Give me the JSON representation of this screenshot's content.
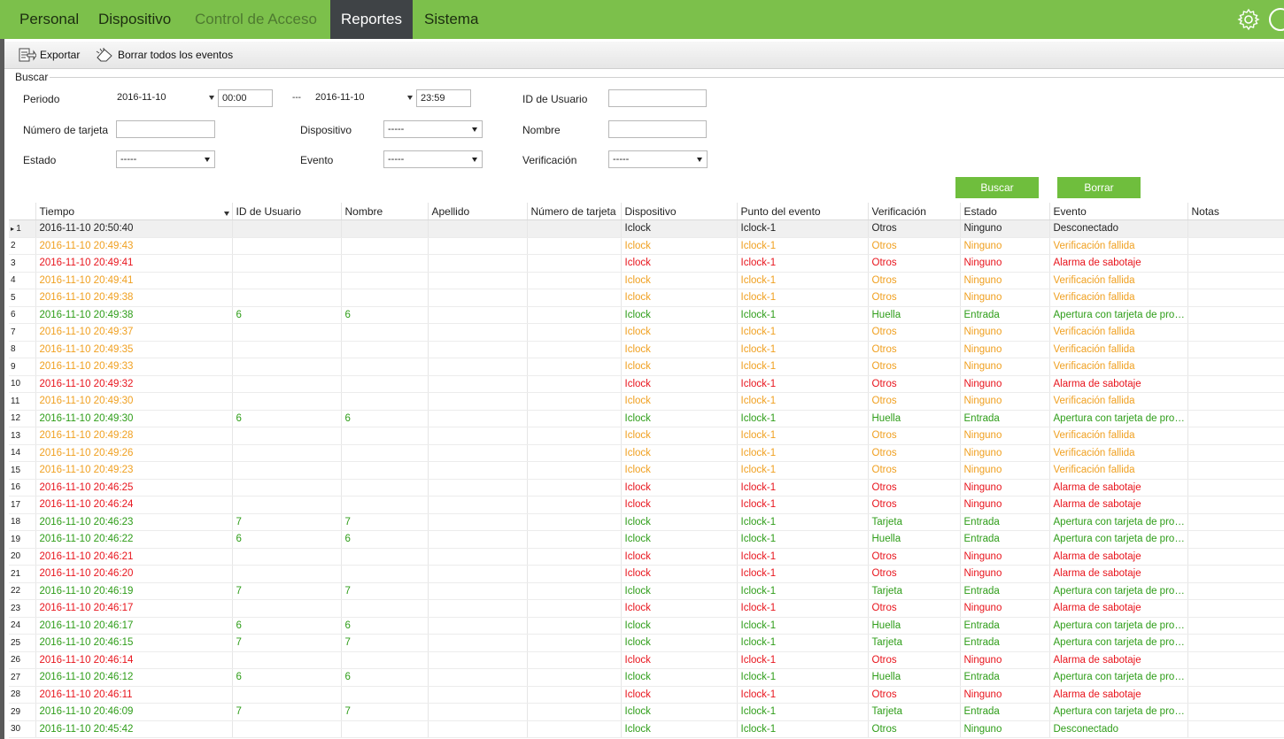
{
  "nav": {
    "tabs": [
      "Personal",
      "Dispositivo",
      "Control de Acceso",
      "Reportes",
      "Sistema"
    ],
    "active": "Reportes"
  },
  "toolbar": {
    "export": "Exportar",
    "clear_all": "Borrar todos los eventos"
  },
  "search": {
    "legend": "Buscar",
    "period_label": "Periodo",
    "date_from": "2016-11-10",
    "time_from": "00:00",
    "separator": "---",
    "date_to": "2016-11-10",
    "time_to": "23:59",
    "user_id_label": "ID de Usuario",
    "card_label": "Número de tarjeta",
    "device_label": "Dispositivo",
    "device_value": "-----",
    "name_label": "Nombre",
    "status_label": "Estado",
    "status_value": "-----",
    "event_label": "Evento",
    "event_value": "-----",
    "verification_label": "Verificación",
    "verification_value": "-----",
    "search_button": "Buscar",
    "clear_button": "Borrar"
  },
  "table": {
    "columns": [
      "Tiempo",
      "ID de Usuario",
      "Nombre",
      "Apellido",
      "Número de tarjeta",
      "Dispositivo",
      "Punto del evento",
      "Verificación",
      "Estado",
      "Evento",
      "Notas"
    ],
    "rows": [
      {
        "n": "1",
        "kind": "normal",
        "time": "2016-11-10 20:50:40",
        "uid": "",
        "name": "",
        "device": "Iclock",
        "point": "Iclock-1",
        "verif": "Otros",
        "status": "Ninguno",
        "event": "Desconectado"
      },
      {
        "n": "2",
        "kind": "warn",
        "time": "2016-11-10 20:49:43",
        "uid": "",
        "name": "",
        "device": "Iclock",
        "point": "Iclock-1",
        "verif": "Otros",
        "status": "Ninguno",
        "event": "Verificación fallida"
      },
      {
        "n": "3",
        "kind": "alarm",
        "time": "2016-11-10 20:49:41",
        "uid": "",
        "name": "",
        "device": "Iclock",
        "point": "Iclock-1",
        "verif": "Otros",
        "status": "Ninguno",
        "event": "Alarma de sabotaje"
      },
      {
        "n": "4",
        "kind": "warn",
        "time": "2016-11-10 20:49:41",
        "uid": "",
        "name": "",
        "device": "Iclock",
        "point": "Iclock-1",
        "verif": "Otros",
        "status": "Ninguno",
        "event": "Verificación fallida"
      },
      {
        "n": "5",
        "kind": "warn",
        "time": "2016-11-10 20:49:38",
        "uid": "",
        "name": "",
        "device": "Iclock",
        "point": "Iclock-1",
        "verif": "Otros",
        "status": "Ninguno",
        "event": "Verificación fallida"
      },
      {
        "n": "6",
        "kind": "ok",
        "time": "2016-11-10 20:49:38",
        "uid": "6",
        "name": "6",
        "device": "Iclock",
        "point": "Iclock-1",
        "verif": "Huella",
        "status": "Entrada",
        "event": "Apertura con tarjeta de prox..."
      },
      {
        "n": "7",
        "kind": "warn",
        "time": "2016-11-10 20:49:37",
        "uid": "",
        "name": "",
        "device": "Iclock",
        "point": "Iclock-1",
        "verif": "Otros",
        "status": "Ninguno",
        "event": "Verificación fallida"
      },
      {
        "n": "8",
        "kind": "warn",
        "time": "2016-11-10 20:49:35",
        "uid": "",
        "name": "",
        "device": "Iclock",
        "point": "Iclock-1",
        "verif": "Otros",
        "status": "Ninguno",
        "event": "Verificación fallida"
      },
      {
        "n": "9",
        "kind": "warn",
        "time": "2016-11-10 20:49:33",
        "uid": "",
        "name": "",
        "device": "Iclock",
        "point": "Iclock-1",
        "verif": "Otros",
        "status": "Ninguno",
        "event": "Verificación fallida"
      },
      {
        "n": "10",
        "kind": "alarm",
        "time": "2016-11-10 20:49:32",
        "uid": "",
        "name": "",
        "device": "Iclock",
        "point": "Iclock-1",
        "verif": "Otros",
        "status": "Ninguno",
        "event": "Alarma de sabotaje"
      },
      {
        "n": "11",
        "kind": "warn",
        "time": "2016-11-10 20:49:30",
        "uid": "",
        "name": "",
        "device": "Iclock",
        "point": "Iclock-1",
        "verif": "Otros",
        "status": "Ninguno",
        "event": "Verificación fallida"
      },
      {
        "n": "12",
        "kind": "ok",
        "time": "2016-11-10 20:49:30",
        "uid": "6",
        "name": "6",
        "device": "Iclock",
        "point": "Iclock-1",
        "verif": "Huella",
        "status": "Entrada",
        "event": "Apertura con tarjeta de prox..."
      },
      {
        "n": "13",
        "kind": "warn",
        "time": "2016-11-10 20:49:28",
        "uid": "",
        "name": "",
        "device": "Iclock",
        "point": "Iclock-1",
        "verif": "Otros",
        "status": "Ninguno",
        "event": "Verificación fallida"
      },
      {
        "n": "14",
        "kind": "warn",
        "time": "2016-11-10 20:49:26",
        "uid": "",
        "name": "",
        "device": "Iclock",
        "point": "Iclock-1",
        "verif": "Otros",
        "status": "Ninguno",
        "event": "Verificación fallida"
      },
      {
        "n": "15",
        "kind": "warn",
        "time": "2016-11-10 20:49:23",
        "uid": "",
        "name": "",
        "device": "Iclock",
        "point": "Iclock-1",
        "verif": "Otros",
        "status": "Ninguno",
        "event": "Verificación fallida"
      },
      {
        "n": "16",
        "kind": "alarm",
        "time": "2016-11-10 20:46:25",
        "uid": "",
        "name": "",
        "device": "Iclock",
        "point": "Iclock-1",
        "verif": "Otros",
        "status": "Ninguno",
        "event": "Alarma de sabotaje"
      },
      {
        "n": "17",
        "kind": "alarm",
        "time": "2016-11-10 20:46:24",
        "uid": "",
        "name": "",
        "device": "Iclock",
        "point": "Iclock-1",
        "verif": "Otros",
        "status": "Ninguno",
        "event": "Alarma de sabotaje"
      },
      {
        "n": "18",
        "kind": "ok",
        "time": "2016-11-10 20:46:23",
        "uid": "7",
        "name": "7",
        "device": "Iclock",
        "point": "Iclock-1",
        "verif": "Tarjeta",
        "status": "Entrada",
        "event": "Apertura con tarjeta de prox..."
      },
      {
        "n": "19",
        "kind": "ok",
        "time": "2016-11-10 20:46:22",
        "uid": "6",
        "name": "6",
        "device": "Iclock",
        "point": "Iclock-1",
        "verif": "Huella",
        "status": "Entrada",
        "event": "Apertura con tarjeta de prox..."
      },
      {
        "n": "20",
        "kind": "alarm",
        "time": "2016-11-10 20:46:21",
        "uid": "",
        "name": "",
        "device": "Iclock",
        "point": "Iclock-1",
        "verif": "Otros",
        "status": "Ninguno",
        "event": "Alarma de sabotaje"
      },
      {
        "n": "21",
        "kind": "alarm",
        "time": "2016-11-10 20:46:20",
        "uid": "",
        "name": "",
        "device": "Iclock",
        "point": "Iclock-1",
        "verif": "Otros",
        "status": "Ninguno",
        "event": "Alarma de sabotaje"
      },
      {
        "n": "22",
        "kind": "ok",
        "time": "2016-11-10 20:46:19",
        "uid": "7",
        "name": "7",
        "device": "Iclock",
        "point": "Iclock-1",
        "verif": "Tarjeta",
        "status": "Entrada",
        "event": "Apertura con tarjeta de prox..."
      },
      {
        "n": "23",
        "kind": "alarm",
        "time": "2016-11-10 20:46:17",
        "uid": "",
        "name": "",
        "device": "Iclock",
        "point": "Iclock-1",
        "verif": "Otros",
        "status": "Ninguno",
        "event": "Alarma de sabotaje"
      },
      {
        "n": "24",
        "kind": "ok",
        "time": "2016-11-10 20:46:17",
        "uid": "6",
        "name": "6",
        "device": "Iclock",
        "point": "Iclock-1",
        "verif": "Huella",
        "status": "Entrada",
        "event": "Apertura con tarjeta de prox..."
      },
      {
        "n": "25",
        "kind": "ok",
        "time": "2016-11-10 20:46:15",
        "uid": "7",
        "name": "7",
        "device": "Iclock",
        "point": "Iclock-1",
        "verif": "Tarjeta",
        "status": "Entrada",
        "event": "Apertura con tarjeta de prox..."
      },
      {
        "n": "26",
        "kind": "alarm",
        "time": "2016-11-10 20:46:14",
        "uid": "",
        "name": "",
        "device": "Iclock",
        "point": "Iclock-1",
        "verif": "Otros",
        "status": "Ninguno",
        "event": "Alarma de sabotaje"
      },
      {
        "n": "27",
        "kind": "ok",
        "time": "2016-11-10 20:46:12",
        "uid": "6",
        "name": "6",
        "device": "Iclock",
        "point": "Iclock-1",
        "verif": "Huella",
        "status": "Entrada",
        "event": "Apertura con tarjeta de prox..."
      },
      {
        "n": "28",
        "kind": "alarm",
        "time": "2016-11-10 20:46:11",
        "uid": "",
        "name": "",
        "device": "Iclock",
        "point": "Iclock-1",
        "verif": "Otros",
        "status": "Ninguno",
        "event": "Alarma de sabotaje"
      },
      {
        "n": "29",
        "kind": "ok",
        "time": "2016-11-10 20:46:09",
        "uid": "7",
        "name": "7",
        "device": "Iclock",
        "point": "Iclock-1",
        "verif": "Tarjeta",
        "status": "Entrada",
        "event": "Apertura con tarjeta de prox..."
      },
      {
        "n": "30",
        "kind": "ok",
        "time": "2016-11-10 20:45:42",
        "uid": "",
        "name": "",
        "device": "Iclock",
        "point": "Iclock-1",
        "verif": "Otros",
        "status": "Ninguno",
        "event": "Desconectado"
      }
    ]
  },
  "colors": {
    "nav_green": "#7cc04b",
    "nav_active": "#3f4346",
    "button_green": "#6fbe3d",
    "warn": "#f0a020",
    "alarm": "#e8141c",
    "ok": "#2e9d18"
  },
  "icons": {
    "settings": "gear-icon",
    "power": "power-icon",
    "export": "export-icon",
    "clear": "eraser-icon",
    "sort": "sort-down-icon"
  }
}
